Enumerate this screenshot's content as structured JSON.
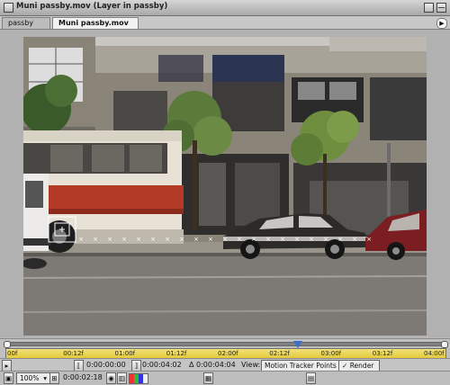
{
  "window": {
    "title": "Muni passby.mov (Layer in passby)"
  },
  "tabs": [
    {
      "label": "passby"
    },
    {
      "label": "Muni passby.mov"
    }
  ],
  "timeline": {
    "ruler_labels": [
      "00f",
      "00:12f",
      "01:00f",
      "01:12f",
      "02:00f",
      "02:12f",
      "03:00f",
      "03:12f",
      "04:00f"
    ],
    "current_time_indicator_fraction": 0.665
  },
  "controls": {
    "in_point": "0:00:00:00",
    "out_point": "0:00:04:02",
    "duration": "Δ 0:00:04:04",
    "view_label": "View:",
    "view_value": "Motion Tracker Points",
    "render_label": "Render",
    "render_checked": true
  },
  "status": {
    "zoom": "100%",
    "current_time": "0:00:02:18"
  },
  "colors": {
    "timeline_ruler": "#e6c93a",
    "bus_stripe": "#b23a26",
    "track_point": "#ffffff"
  }
}
